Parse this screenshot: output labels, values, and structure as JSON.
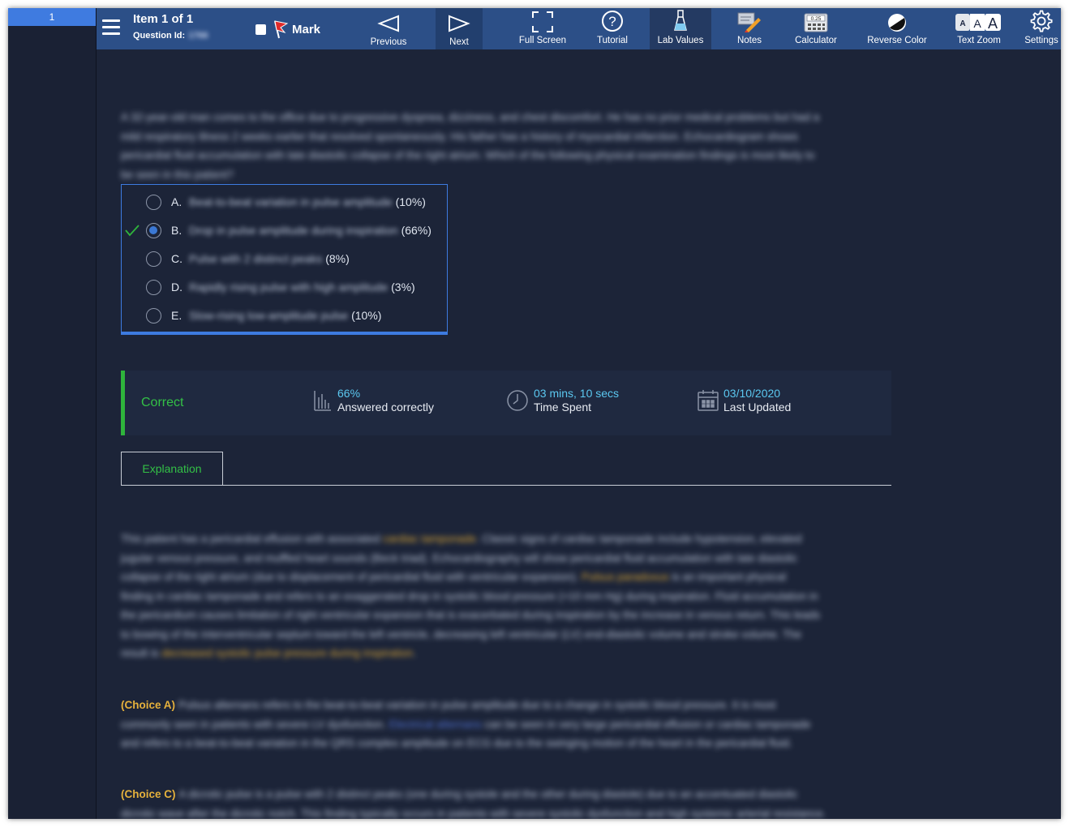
{
  "item_list": {
    "items": [
      "1"
    ]
  },
  "header": {
    "item_title": "Item 1 of 1",
    "question_id_label": "Question Id:",
    "question_id_value": "1766",
    "mark_label": "Mark"
  },
  "toolbar": {
    "previous": "Previous",
    "next": "Next",
    "full_screen": "Full Screen",
    "tutorial": "Tutorial",
    "lab_values": "Lab Values",
    "notes": "Notes",
    "calculator": "Calculator",
    "calculator_display": "0.25",
    "reverse_color": "Reverse Color",
    "text_zoom": "Text Zoom",
    "settings": "Settings"
  },
  "question": {
    "stem_lines": [
      "A 32-year-old man comes to the office due to progressive dyspnea, dizziness, and chest discomfort.  He has no prior medical problems but had a",
      "mild respiratory illness 2 weeks earlier that resolved spontaneously.  His father has a history of myocardial infarction.  Echocardiogram shows",
      "pericardial fluid accumulation with late diastolic collapse of the right atrium.  Which of the following physical examination findings is most likely to",
      "be seen in this patient?"
    ],
    "choices": [
      {
        "letter": "A.",
        "text": "Beat-to-beat variation in pulse amplitude",
        "pct": "(10%)"
      },
      {
        "letter": "B.",
        "text": "Drop in pulse amplitude during inspiration",
        "pct": "(66%)"
      },
      {
        "letter": "C.",
        "text": "Pulse with 2 distinct peaks",
        "pct": "(8%)"
      },
      {
        "letter": "D.",
        "text": "Rapidly rising pulse with high amplitude",
        "pct": "(3%)"
      },
      {
        "letter": "E.",
        "text": "Slow-rising low-amplitude pulse",
        "pct": "(10%)"
      }
    ]
  },
  "result": {
    "status": "Correct",
    "pct_value": "66%",
    "pct_label": "Answered correctly",
    "time_value": "03 mins, 10 secs",
    "time_label": "Time Spent",
    "date_value": "03/10/2020",
    "date_label": "Last Updated"
  },
  "tabs": {
    "explanation": "Explanation"
  },
  "explanation": {
    "p1": [
      "This patient has a pericardial effusion with associated ",
      "cardiac tamponade",
      ".  Classic signs of cardiac tamponade include hypotension, elevated",
      "jugular venous pressure, and muffled heart sounds (Beck triad).  Echocardiography will show pericardial fluid accumulation with late diastolic",
      "collapse of the right atrium (due to displacement of pericardial fluid with ventricular expansion).  ",
      "Pulsus paradoxus",
      " is an important physical",
      "finding in cardiac tamponade and refers to an exaggerated drop in systolic blood pressure (>10 mm Hg) during inspiration.  Fluid accumulation in",
      "the pericardium causes limitation of right ventricular expansion that is exacerbated during inspiration by the increase in venous return.  This leads",
      "to bowing of the interventricular septum toward the left ventricle, decreasing left ventricular (LV) end-diastolic volume and stroke volume.  The",
      "result is ",
      "decreased systolic pulse pressure during inspiration",
      "."
    ],
    "choice_a_label": "(Choice A)",
    "choice_a": [
      "Pulsus alternans refers to the beat-to-beat variation in pulse amplitude due to a change in systolic blood pressure.  It is most",
      "commonly seen in patients with severe LV dysfunction.  ",
      "Electrical alternans",
      " can be seen in very large pericardial effusion or cardiac tamponade",
      "and refers to a beat-to-beat variation in the QRS complex amplitude on ECG due to the swinging motion of the heart in the pericardial fluid."
    ],
    "choice_c_label": "(Choice C)",
    "choice_c": [
      "A dicrotic pulse is a pulse with 2 distinct peaks (one during systole and the other during diastole) due to an accentuated diastolic",
      "dicrotic wave after the dicrotic notch.  This finding typically occurs in patients with severe systolic dysfunction and high systemic arterial resistance."
    ]
  }
}
